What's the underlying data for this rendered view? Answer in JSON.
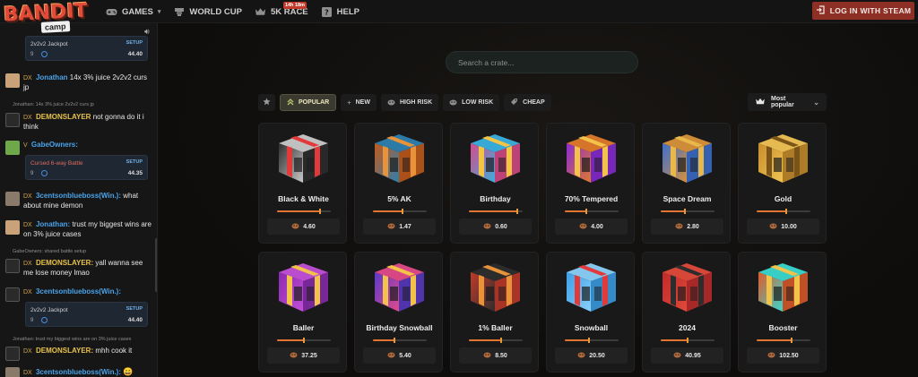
{
  "header": {
    "logo_text": "BANDIT",
    "logo_sub": "camp",
    "nav": [
      {
        "label": "GAMES",
        "icon": "gamepad-icon",
        "has_dropdown": true
      },
      {
        "label": "WORLD CUP",
        "icon": "world-cup-icon"
      },
      {
        "label": "5K RACE",
        "icon": "crown-icon",
        "badge": "14h 18m"
      },
      {
        "label": "HELP",
        "icon": "help-icon"
      }
    ],
    "login_label": "LOG IN WITH STEAM"
  },
  "chat": {
    "messages": [
      {
        "card_title": "2v2v2 Jackpot",
        "card_setup": "SETUP",
        "card_num": "9",
        "card_amount": "44.40"
      },
      {
        "user": "Jonathan",
        "level": "DX",
        "text": "14x 3% juice 2v2v2 curs jp"
      },
      {
        "reply": "Jonathan: 14x 3% juice 2v2v2 curs jp",
        "user": "DEMONSLAYER",
        "level": "DX",
        "text": "not gonna do it i think"
      },
      {
        "user": "GabeOwners:",
        "level": "V",
        "card_title": "Cursed 6-way Battle",
        "card_setup": "SETUP",
        "card_num": "9",
        "card_amount": "44.35"
      },
      {
        "user": "3centsonblueboss(Win.):",
        "level": "DX",
        "text": "what about mine demon"
      },
      {
        "user": "Jonathan:",
        "level": "DX",
        "text": "trust my biggest wins are on 3% juice cases"
      },
      {
        "reply": "GabeOwners: shared battle setup",
        "user": "DEMONSLAYER:",
        "level": "DX",
        "text": "yall wanna see me lose money lmao"
      },
      {
        "user": "3centsonblueboss(Win.):",
        "level": "DX",
        "card_title": "2v2v2 Jackpot",
        "card_setup": "SETUP",
        "card_num": "9",
        "card_amount": "44.40"
      },
      {
        "reply": "Jonathan: trust my biggest wins are on 3% juice cases",
        "user": "DEMONSLAYER:",
        "level": "DX",
        "text": "mhh cook it"
      },
      {
        "user": "3centsonblueboss(Win.):",
        "level": "DX"
      }
    ]
  },
  "search": {
    "placeholder": "Search a crate..."
  },
  "filters": [
    {
      "label": "",
      "icon": "star-icon"
    },
    {
      "label": "POPULAR",
      "icon": "chevrons-up-icon",
      "active": true
    },
    {
      "label": "NEW",
      "icon": "plus-icon"
    },
    {
      "label": "HIGH RISK",
      "icon": "risk-icon"
    },
    {
      "label": "LOW RISK",
      "icon": "risk-icon"
    },
    {
      "label": "CHEAP",
      "icon": "cheap-icon"
    }
  ],
  "sort": {
    "label": "Most popular",
    "icon": "crown-icon"
  },
  "crates": [
    {
      "name": "Black & White",
      "price": "4.60",
      "risk": 0.8,
      "colors": [
        "#2d2d2d",
        "#c9c9c9",
        "#e23a3a"
      ]
    },
    {
      "name": "5% AK",
      "price": "1.47",
      "risk": 0.55,
      "colors": [
        "#c45a1a",
        "#2d7fb0",
        "#e8933a"
      ]
    },
    {
      "name": "Birthday",
      "price": "0.60",
      "risk": 0.9,
      "colors": [
        "#d94a8a",
        "#3ab0e0",
        "#f4c542"
      ]
    },
    {
      "name": "70% Tempered",
      "price": "4.00",
      "risk": 0.4,
      "colors": [
        "#8a2ad8",
        "#e07a2a",
        "#f2c24a"
      ]
    },
    {
      "name": "Space Dream",
      "price": "2.80",
      "risk": 0.45,
      "colors": [
        "#3c6fcf",
        "#d8913a",
        "#e8b84a"
      ]
    },
    {
      "name": "Gold",
      "price": "10.00",
      "risk": 0.55,
      "colors": [
        "#c98d2a",
        "#f0c454",
        "#7a5418"
      ]
    },
    {
      "name": "Baller",
      "price": "37.25",
      "risk": 0.5,
      "colors": [
        "#8a2ab0",
        "#c34fd8",
        "#f2c24a"
      ]
    },
    {
      "name": "Birthday Snowball",
      "price": "5.40",
      "risk": 0.4,
      "colors": [
        "#5a3ac8",
        "#e24a8a",
        "#f2c24a"
      ]
    },
    {
      "name": "1% Baller",
      "price": "8.50",
      "risk": 0.6,
      "colors": [
        "#c23a2a",
        "#2d2d2d",
        "#e8933a"
      ]
    },
    {
      "name": "Snowball",
      "price": "20.50",
      "risk": 0.45,
      "colors": [
        "#3aa0e8",
        "#8ad0f8",
        "#e23a3a"
      ]
    },
    {
      "name": "2024",
      "price": "40.95",
      "risk": 0.5,
      "colors": [
        "#c22a2a",
        "#e04a3a",
        "#2d2d2d"
      ]
    },
    {
      "name": "Booster",
      "price": "102.50",
      "risk": 0.65,
      "colors": [
        "#e05a2a",
        "#3ad8d0",
        "#f2c24a"
      ]
    }
  ]
}
